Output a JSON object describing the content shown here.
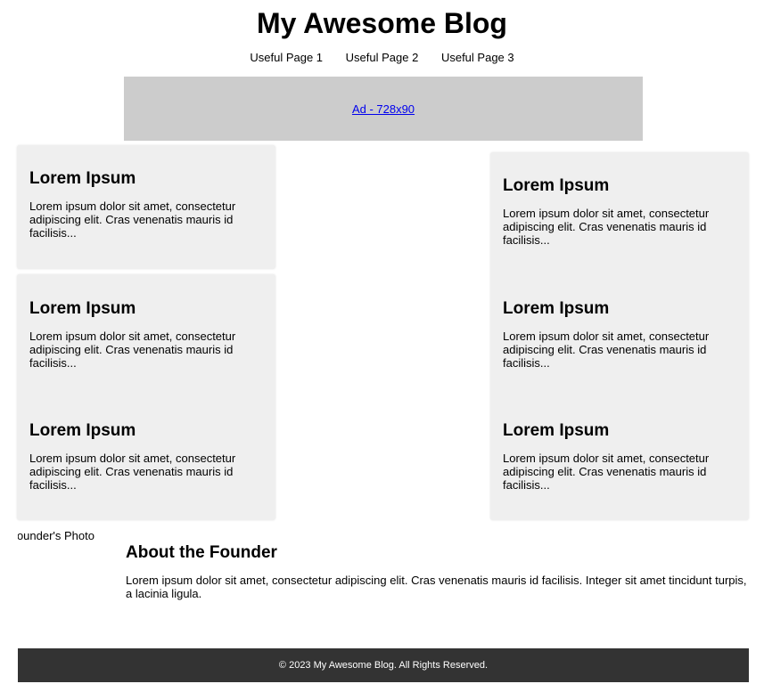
{
  "site": {
    "title": "My Awesome Blog"
  },
  "nav": {
    "items": [
      "Useful Page 1",
      "Useful Page 2",
      "Useful Page 3"
    ]
  },
  "ad": {
    "label": "Ad - 728x90"
  },
  "posts": [
    {
      "title": "Lorem Ipsum",
      "excerpt": "Lorem ipsum dolor sit amet, consectetur adipiscing elit. Cras venenatis mauris id facilisis..."
    },
    {
      "title": "Lorem Ipsum",
      "excerpt": "Lorem ipsum dolor sit amet, consectetur adipiscing elit. Cras venenatis mauris id facilisis..."
    },
    {
      "title": "Lorem Ipsum",
      "excerpt": "Lorem ipsum dolor sit amet, consectetur adipiscing elit. Cras venenatis mauris id facilisis..."
    },
    {
      "title": "Lorem Ipsum",
      "excerpt": "Lorem ipsum dolor sit amet, consectetur adipiscing elit. Cras venenatis mauris id facilisis..."
    },
    {
      "title": "Lorem Ipsum",
      "excerpt": "Lorem ipsum dolor sit amet, consectetur adipiscing elit. Cras venenatis mauris id facilisis..."
    },
    {
      "title": "Lorem Ipsum",
      "excerpt": "Lorem ipsum dolor sit amet, consectetur adipiscing elit. Cras venenatis mauris id facilisis..."
    }
  ],
  "founder": {
    "image_alt": "Founder's Photo",
    "heading": "About the Founder",
    "bio": "Lorem ipsum dolor sit amet, consectetur adipiscing elit. Cras venenatis mauris id facilisis. Integer sit amet tincidunt turpis, a lacinia ligula."
  },
  "footer": {
    "text": "© 2023 My Awesome Blog. All Rights Reserved."
  },
  "colors": {
    "ad_bg": "#cccccc",
    "card_bg": "#efefef",
    "footer_bg": "#333333",
    "link": "#0000ee"
  }
}
